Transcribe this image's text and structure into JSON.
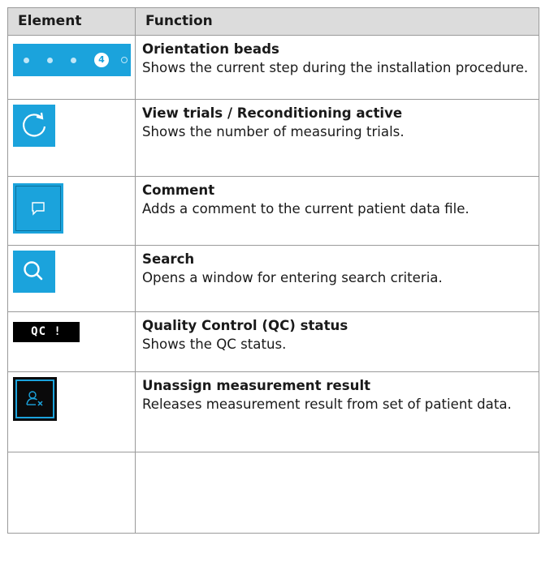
{
  "header": {
    "col1": "Element",
    "col2": "Function"
  },
  "rows": [
    {
      "title": "Orientation beads",
      "desc": "Shows the current step during the installation procedure.",
      "icon": "orientation-beads-icon",
      "bead_number": "4"
    },
    {
      "title": "View trials / Reconditioning active",
      "desc": "Shows the number of measuring trials.",
      "icon": "refresh-icon"
    },
    {
      "title": "Comment",
      "desc": "Adds a comment to the current patient data file.",
      "icon": "comment-icon"
    },
    {
      "title": "Search",
      "desc": "Opens a window for entering search criteria.",
      "icon": "search-icon"
    },
    {
      "title": "Quality Control (QC) status",
      "desc": "Shows the QC status.",
      "icon": "qc-status-icon",
      "badge": "QC !"
    },
    {
      "title": "Unassign measurement result",
      "desc": "Releases measurement result from set of patient data.",
      "icon": "unassign-user-icon"
    },
    {
      "title": "",
      "desc": ""
    }
  ],
  "colors": {
    "accent": "#1ba3dc",
    "header_bg": "#dcdcdc",
    "border": "#9a9a9a"
  }
}
